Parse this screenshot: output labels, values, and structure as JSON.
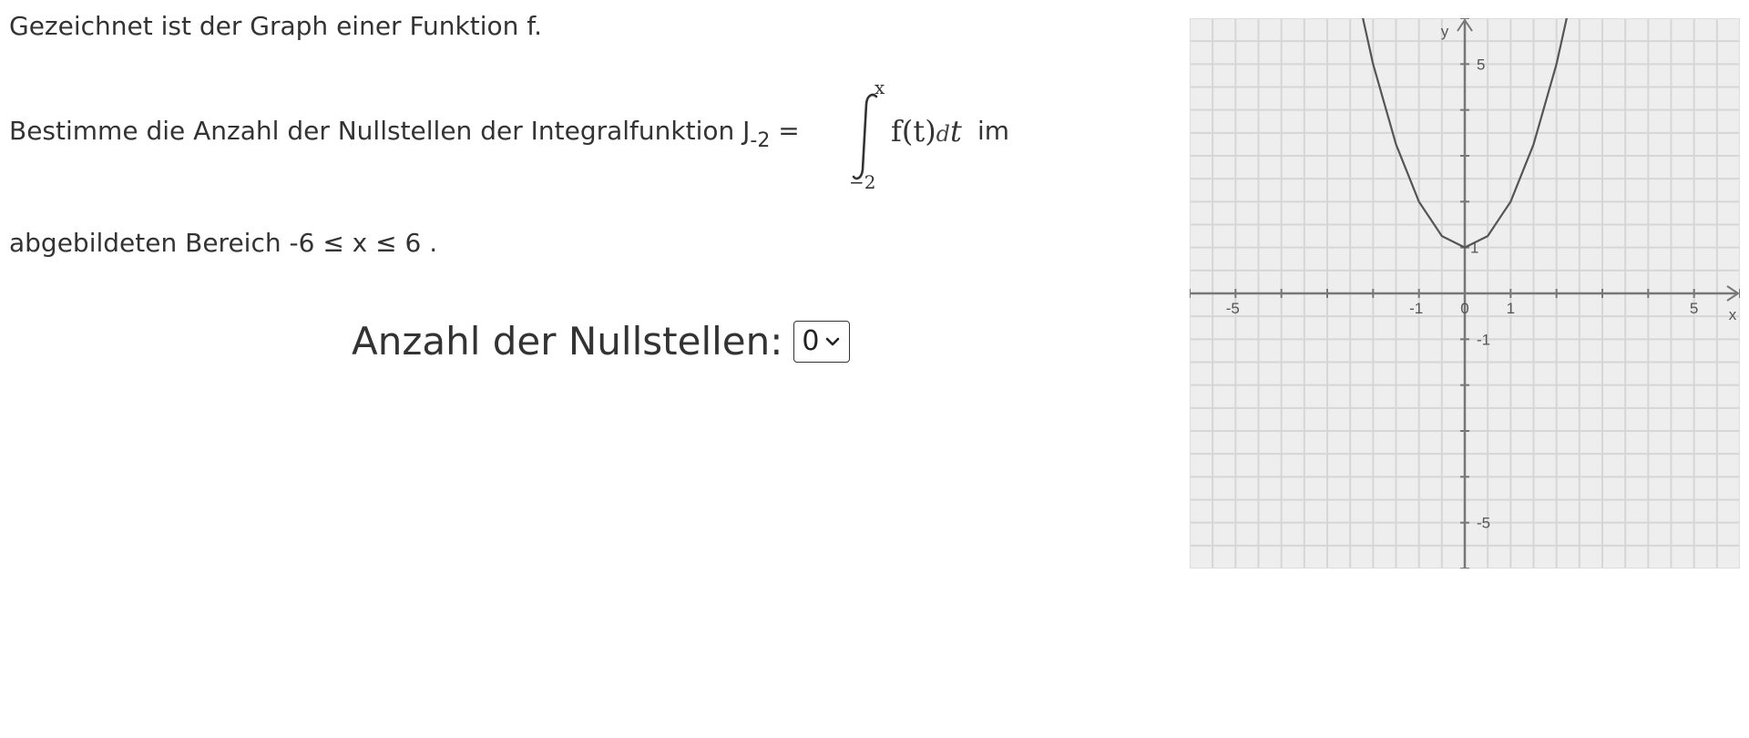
{
  "task": {
    "line1": "Gezeichnet ist der Graph einer Funktion f.",
    "line2_before": "Bestimme die Anzahl der Nullstellen der Integralfunktion J",
    "line2_sub": "-2",
    "line2_eq": " =",
    "line2_after": " im",
    "line3": "abgebildeten Bereich -6 ≤ x ≤ 6 ."
  },
  "integral": {
    "upper": "x",
    "lower": "−2",
    "integrand": "f(t)",
    "differential": "d",
    "variable": "t"
  },
  "answer": {
    "label": "Anzahl der Nullstellen:",
    "selected": "0"
  },
  "graph": {
    "x_axis_label": "x",
    "y_axis_label": "y",
    "x_tick_labels": [
      "-5",
      "-1",
      "0",
      "1",
      "5"
    ],
    "y_tick_labels": [
      "5",
      "1",
      "-1",
      "-5"
    ],
    "colors": {
      "background": "#eeeeee",
      "grid": "#d6d6d6",
      "axis": "#777777",
      "curve": "#555555"
    }
  },
  "chart_data": {
    "type": "line",
    "xlim": [
      -6,
      6
    ],
    "ylim": [
      -6,
      6
    ],
    "grid": true,
    "xlabel": "x",
    "ylabel": "y",
    "series": [
      {
        "x": [
          -2.5,
          -2,
          -1.5,
          -1,
          -0.5,
          0,
          0.5,
          1,
          1.5,
          2,
          2.5
        ],
        "y": [
          7.25,
          5,
          3.25,
          2,
          1.25,
          1,
          1.25,
          2,
          3.25,
          5,
          7.25
        ]
      }
    ]
  }
}
